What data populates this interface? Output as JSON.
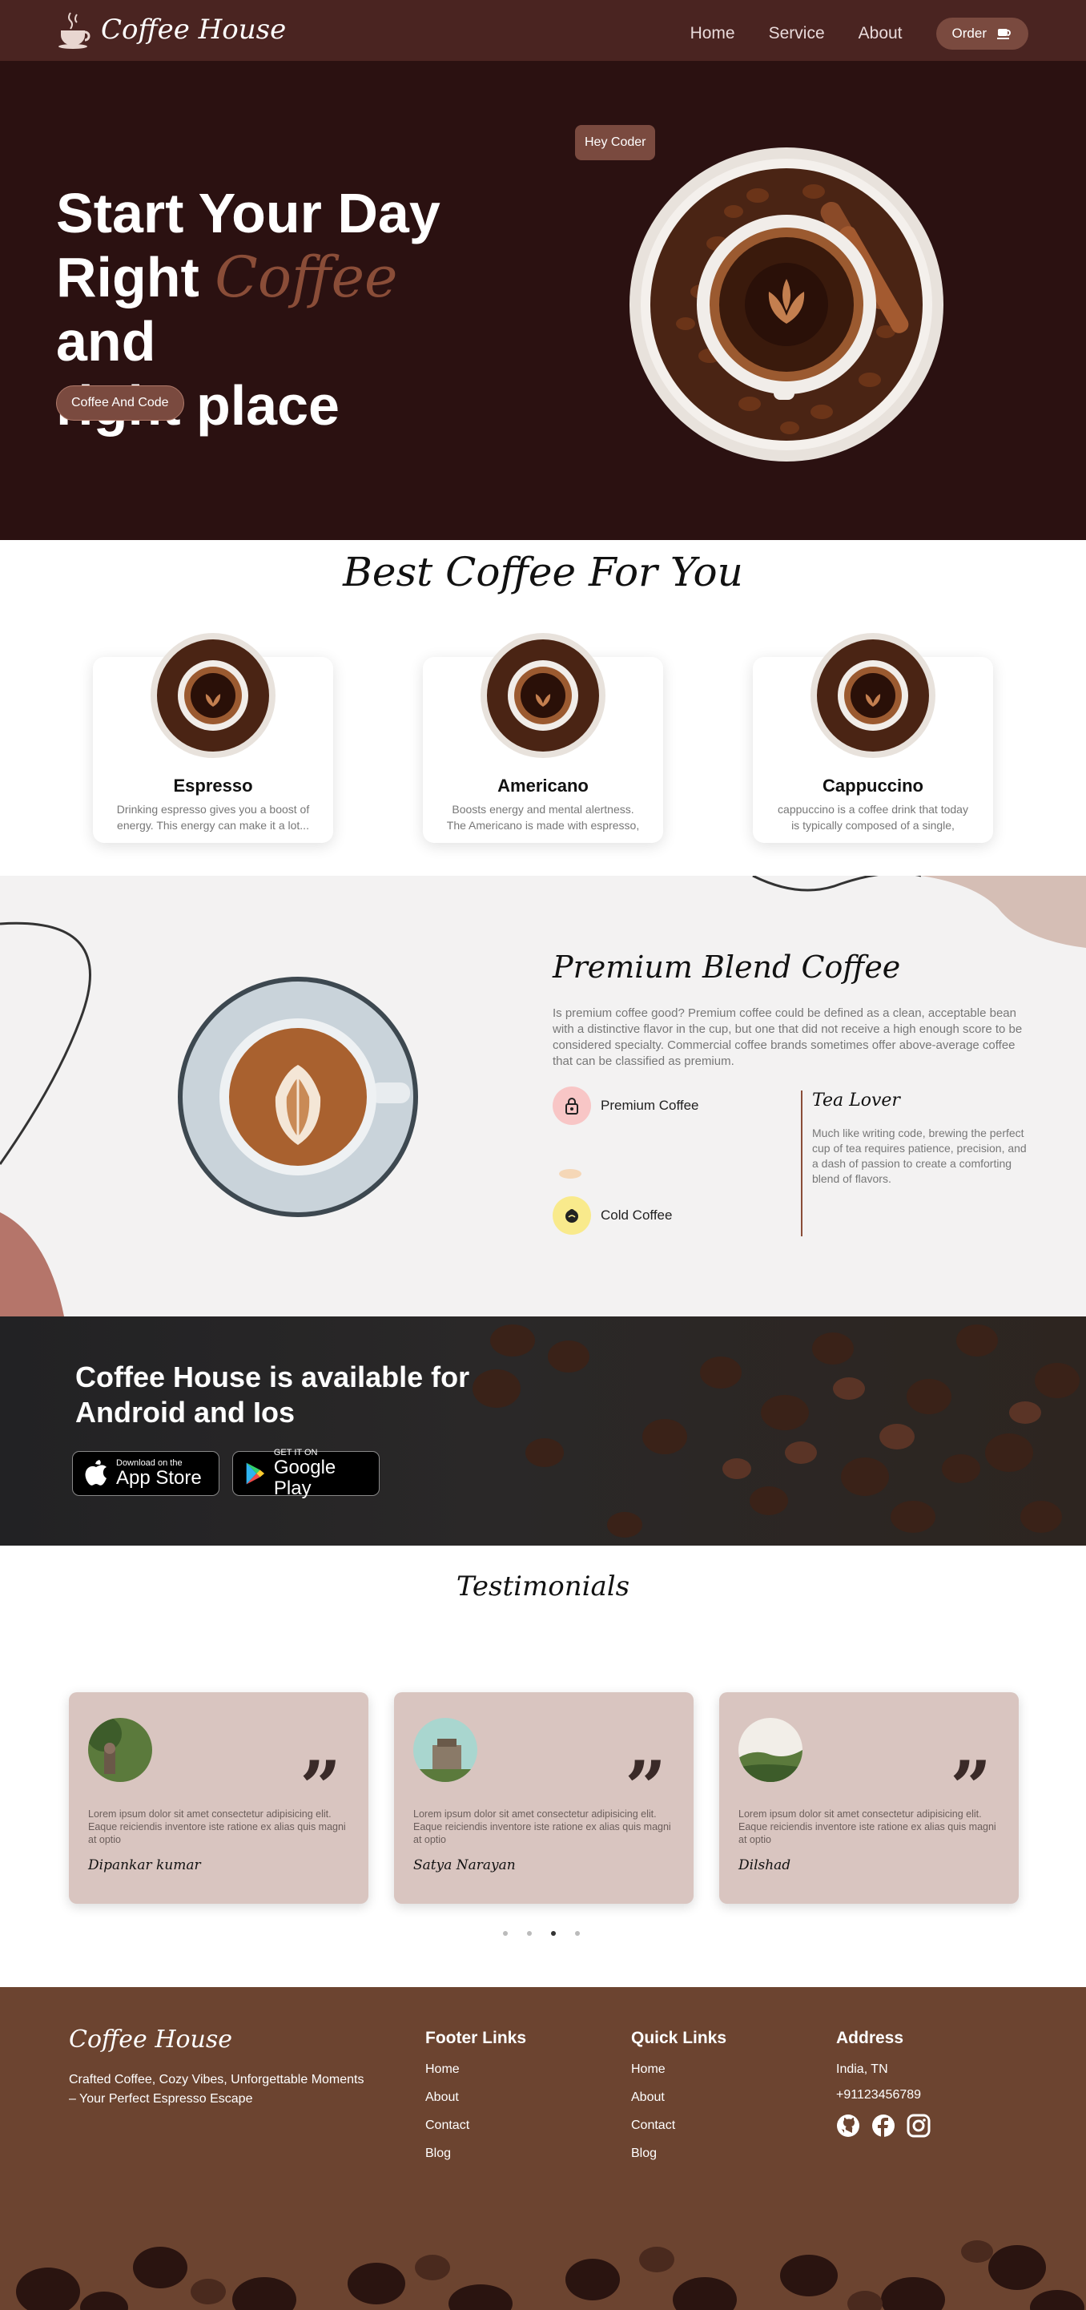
{
  "nav": {
    "brand": "Coffee House",
    "links": [
      "Home",
      "Service",
      "About"
    ],
    "order_label": "Order"
  },
  "hero": {
    "title_line1": "Start Your Day",
    "title_right": "Right",
    "title_coffee": "Coffee",
    "title_and": "and",
    "title_line3": "right place",
    "button_label": "Coffee And Code",
    "badge": "Hey Coder"
  },
  "best": {
    "title": "Best Coffee For You",
    "cards": [
      {
        "name": "Espresso",
        "desc": "Drinking espresso gives you a boost of energy. This energy can make it a lot..."
      },
      {
        "name": "Americano",
        "desc": "Boosts energy and mental alertness. The Americano is made with espresso, which..."
      },
      {
        "name": "Cappuccino",
        "desc": "cappuccino is a coffee drink that today is typically composed of a single, double, o..."
      }
    ]
  },
  "premium": {
    "title": "Premium Blend Coffee",
    "desc": "Is premium coffee good? Premium coffee could be defined as a clean, acceptable bean with a distinctive flavor in the cup, but one that did not receive a high enough score to be considered specialty. Commercial coffee brands sometimes offer above-average coffee that can be classified as premium.",
    "features": [
      "Premium Coffee",
      "Cold Coffee"
    ],
    "tea_title": "Tea Lover",
    "tea_desc": "Much like writing code, brewing the perfect cup of tea requires patience, precision, and a dash of passion to create a comforting blend of flavors."
  },
  "app": {
    "title": "Coffee House is available for Android and Ios",
    "appstore_small": "Download on the",
    "appstore_big": "App Store",
    "googleplay_small": "GET IT ON",
    "googleplay_big": "Google Play"
  },
  "testimonials": {
    "title": "Testimonials",
    "items": [
      {
        "text": "Lorem ipsum dolor sit amet consectetur adipisicing elit. Eaque reiciendis inventore iste ratione ex alias quis magni at optio",
        "name": "Dipankar kumar"
      },
      {
        "text": "Lorem ipsum dolor sit amet consectetur adipisicing elit. Eaque reiciendis inventore iste ratione ex alias quis magni at optio",
        "name": "Satya Narayan"
      },
      {
        "text": "Lorem ipsum dolor sit amet consectetur adipisicing elit. Eaque reiciendis inventore iste ratione ex alias quis magni at optio",
        "name": "Dilshad"
      }
    ]
  },
  "footer": {
    "brand": "Coffee House",
    "tagline": "Crafted Coffee, Cozy Vibes, Unforgettable Moments – Your Perfect Espresso Escape",
    "footer_links_title": "Footer Links",
    "footer_links": [
      "Home",
      "About",
      "Contact",
      "Blog"
    ],
    "quick_links_title": "Quick Links",
    "quick_links": [
      "Home",
      "About",
      "Contact",
      "Blog"
    ],
    "address_title": "Address",
    "address_line": "India, TN",
    "phone": "+91123456789",
    "socials": [
      "github-icon",
      "facebook-icon",
      "instagram-icon"
    ]
  },
  "colors": {
    "nav_bg": "#4a2421",
    "hero_bg": "#2b1111",
    "accent": "#7a4a3f",
    "testimonial_card": "#d9c5c0",
    "footer_bg": "#6c4430"
  }
}
